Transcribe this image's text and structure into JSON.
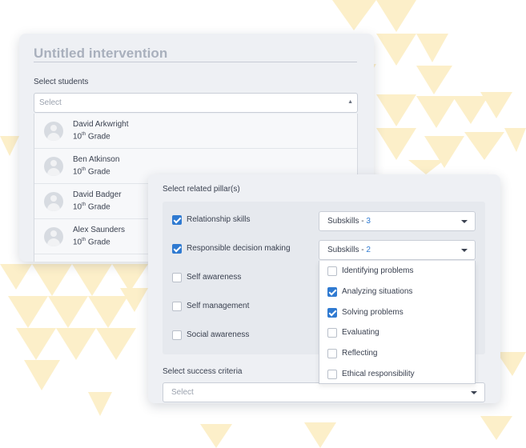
{
  "colors": {
    "accent": "#2f7ad1",
    "card_bg": "#eef0f4",
    "decor_triangles": "#fcefc9"
  },
  "intervention": {
    "title": "Untitled intervention",
    "students_label": "Select students",
    "students_placeholder": "Select",
    "caret_icon": "caret-up-icon",
    "students": [
      {
        "name": "David Arkwright",
        "grade_num": "10",
        "grade_sup": "th",
        "grade_word": "Grade"
      },
      {
        "name": "Ben Atkinson",
        "grade_num": "10",
        "grade_sup": "th",
        "grade_word": "Grade"
      },
      {
        "name": "David Badger",
        "grade_num": "10",
        "grade_sup": "th",
        "grade_word": "Grade"
      },
      {
        "name": "Alex Saunders",
        "grade_num": "10",
        "grade_sup": "th",
        "grade_word": "Grade"
      }
    ]
  },
  "pillars": {
    "label": "Select related pillar(s)",
    "items": [
      {
        "label": "Relationship skills",
        "checked": true
      },
      {
        "label": "Responsible decision making",
        "checked": true
      },
      {
        "label": "Self awareness",
        "checked": false
      },
      {
        "label": "Self management",
        "checked": false
      },
      {
        "label": "Social awareness",
        "checked": false
      }
    ],
    "subskill_selects": [
      {
        "prefix": "Subskills - ",
        "count": "3"
      },
      {
        "prefix": "Subskills - ",
        "count": "2"
      }
    ],
    "subskill_options": [
      {
        "label": "Identifying problems",
        "checked": false
      },
      {
        "label": "Analyzing situations",
        "checked": true
      },
      {
        "label": "Solving problems",
        "checked": true
      },
      {
        "label": "Evaluating",
        "checked": false
      },
      {
        "label": "Reflecting",
        "checked": false
      },
      {
        "label": "Ethical responsibility",
        "checked": false
      }
    ]
  },
  "criteria": {
    "label": "Select success criteria",
    "placeholder": "Select"
  }
}
